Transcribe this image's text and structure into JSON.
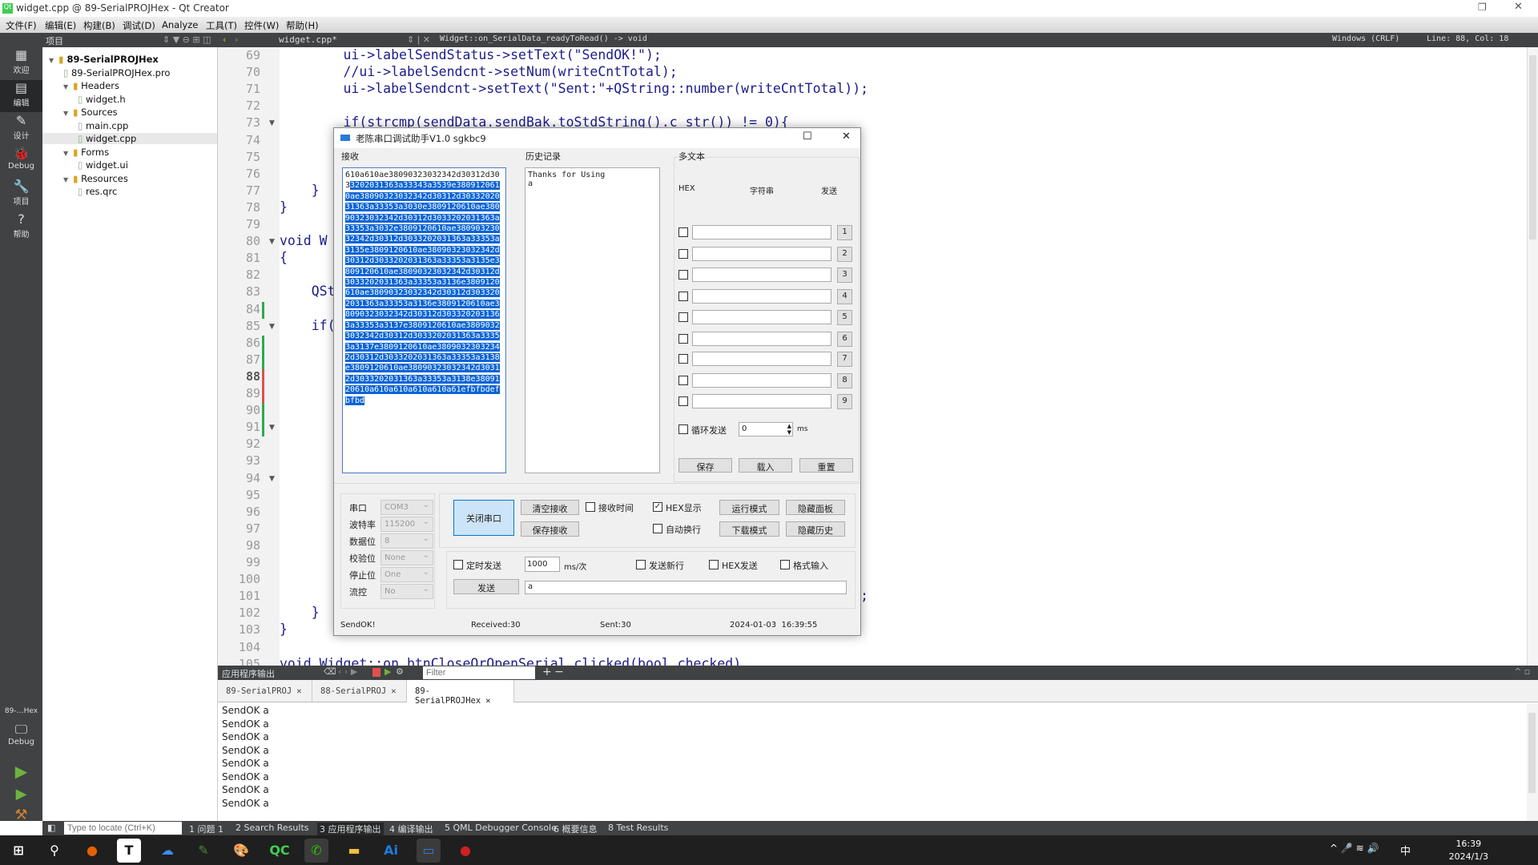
{
  "window": {
    "title": "widget.cpp @ 89-SerialPROJHex - Qt Creator"
  },
  "menu": [
    "文件(F)",
    "编辑(E)",
    "构建(B)",
    "调试(D)",
    "Analyze",
    "工具(T)",
    "控件(W)",
    "帮助(H)"
  ],
  "toolbar": {
    "project_label": "项目",
    "file_tab": "widget.cpp*",
    "function": "Widget::on_SerialData_readyToRead() -> void",
    "line_ending": "Windows (CRLF)",
    "position": "Line: 88, Col: 18"
  },
  "modes": [
    {
      "label": "欢迎",
      "icon": "grid-icon"
    },
    {
      "label": "编辑",
      "icon": "edit-icon"
    },
    {
      "label": "设计",
      "icon": "pen-icon"
    },
    {
      "label": "Debug",
      "icon": "bug-icon"
    },
    {
      "label": "项目",
      "icon": "wrench-icon"
    },
    {
      "label": "帮助",
      "icon": "help-icon"
    }
  ],
  "modes_bottom": {
    "project": "89-…Hex",
    "kit": "Debug"
  },
  "tree": [
    {
      "label": "89-SerialPROJHex",
      "depth": 0,
      "bold": true
    },
    {
      "label": "89-SerialPROJHex.pro",
      "depth": 1
    },
    {
      "label": "Headers",
      "depth": 1
    },
    {
      "label": "widget.h",
      "depth": 2
    },
    {
      "label": "Sources",
      "depth": 1
    },
    {
      "label": "main.cpp",
      "depth": 2
    },
    {
      "label": "widget.cpp",
      "depth": 2,
      "selected": true
    },
    {
      "label": "Forms",
      "depth": 1
    },
    {
      "label": "widget.ui",
      "depth": 2
    },
    {
      "label": "Resources",
      "depth": 1
    },
    {
      "label": "res.qrc",
      "depth": 2
    }
  ],
  "editor": {
    "current_line": 88,
    "lines": [
      {
        "n": 69,
        "text": "        ui->labelSendStatus->setText(\"SendOK!\");"
      },
      {
        "n": 70,
        "text": "        //ui->labelSendcnt->setNum(writeCntTotal);"
      },
      {
        "n": 71,
        "text": "        ui->labelSendcnt->setText(\"Sent:\"+QString::number(writeCntTotal));"
      },
      {
        "n": 72,
        "text": ""
      },
      {
        "n": 73,
        "text": "        if(strcmp(sendData.sendBak.toStdString().c_str()) != 0){",
        "fold": true
      },
      {
        "n": 74,
        "text": ""
      },
      {
        "n": 75,
        "text": ""
      },
      {
        "n": 76,
        "text": ""
      },
      {
        "n": 77,
        "text": "    }"
      },
      {
        "n": 78,
        "text": "}"
      },
      {
        "n": 79,
        "text": ""
      },
      {
        "n": 80,
        "text": "void W",
        "fold": true
      },
      {
        "n": 81,
        "text": "{"
      },
      {
        "n": 82,
        "text": ""
      },
      {
        "n": 83,
        "text": "    QSt"
      },
      {
        "n": 84,
        "text": "",
        "mark": "green"
      },
      {
        "n": 85,
        "text": "    if(",
        "fold": true
      },
      {
        "n": 86,
        "text": "",
        "mark": "green"
      },
      {
        "n": 87,
        "text": "",
        "mark": "green"
      },
      {
        "n": 88,
        "text": "",
        "mark": "red"
      },
      {
        "n": 89,
        "text": "",
        "mark": "red"
      },
      {
        "n": 90,
        "text": "",
        "mark": "green"
      },
      {
        "n": 91,
        "text": "",
        "fold": true,
        "mark": "green"
      },
      {
        "n": 92,
        "text": ""
      },
      {
        "n": 93,
        "text": ""
      },
      {
        "n": 94,
        "text": "",
        "fold": true
      },
      {
        "n": 95,
        "text": ""
      },
      {
        "n": 96,
        "text": ""
      },
      {
        "n": 97,
        "text": ""
      },
      {
        "n": 98,
        "text": ""
      },
      {
        "n": 99,
        "text": ""
      },
      {
        "n": 100,
        "text": ""
      },
      {
        "n": 101,
        "text": "                                                                       ));"
      },
      {
        "n": 102,
        "text": "    }"
      },
      {
        "n": 103,
        "text": "}"
      },
      {
        "n": 104,
        "text": ""
      },
      {
        "n": 105,
        "text": "void Widget::on_btnCloseOrOpenSerial_clicked(bool checked)"
      }
    ]
  },
  "output": {
    "title": "应用程序输出",
    "filter_placeholder": "Filter",
    "tabs": [
      {
        "label": "89-SerialPROJ"
      },
      {
        "label": "88-SerialPROJ"
      },
      {
        "label": "89-SerialPROJHex",
        "active": true
      }
    ],
    "lines": [
      "SendOK a",
      "SendOK a",
      "SendOK a",
      "SendOK a",
      "SendOK a",
      "SendOK a",
      "SendOK a",
      "SendOK a"
    ]
  },
  "statusbar": {
    "locate_placeholder": "Type to locate (Ctrl+K)",
    "items": [
      "1 问题 1",
      "2 Search Results",
      "3 应用程序输出",
      "4 编译输出",
      "5 QML Debugger Console",
      "6 概要信息",
      "8 Test Results"
    ],
    "active_index": 2
  },
  "taskbar": {
    "apps": [
      "windows-start",
      "search",
      "firefox",
      "typora",
      "baidu-netdisk",
      "notepad",
      "paint",
      "qt-creator",
      "wechat",
      "file-explorer",
      "ai-app",
      "serial-tool",
      "recorder"
    ],
    "time": "16:39",
    "date": "2024/1/3",
    "ime": "中"
  },
  "dialog": {
    "title": "老陈串口调试助手V1.0 sgkbc9",
    "recv_label": "接收",
    "recv_plain": "610a610ae38090323032342d30312d303",
    "recv_selected": "3202031363a33343a3539e3809120610ae38090323032342d30312d3033202031363a33353a3030e3809120610ae38090323032342d30312d3033202031363a33353a3032e3809120610ae38090323032342d30312d3033202031363a33353a3135e3809120610ae38090323032342d30312d3033202031363a33353a3135e3809120610ae38090323032342d30312d3033202031363a33353a3136e3809120610ae38090323032342d30312d3033202031363a33353a3136e3809120610ae38090323032342d30312d3033202031363a33353a3137e3809120610ae38090323032342d30312d3033202031363a33353a3137e3809120610ae38090323032342d30312d3033202031363a33353a3138e3809120610ae38090323032342d30312d3033202031363a33353a3138e3809120610a610a610a610a610a61efbfbdefbfbd",
    "history_label": "历史记录",
    "history_text": "Thanks for Using\na",
    "multi": {
      "label": "多文本",
      "col_hex": "HEX",
      "col_str": "字符串",
      "col_send": "发送",
      "rows": [
        "1",
        "2",
        "3",
        "4",
        "5",
        "6",
        "7",
        "8",
        "9"
      ],
      "loop_label": "循环发送",
      "loop_value": "0",
      "loop_unit": "ms",
      "save": "保存",
      "load": "载入",
      "reset": "重置"
    },
    "settings": [
      {
        "label": "串口",
        "value": "COM3"
      },
      {
        "label": "波特率",
        "value": "115200"
      },
      {
        "label": "数据位",
        "value": "8"
      },
      {
        "label": "校验位",
        "value": "None"
      },
      {
        "label": "停止位",
        "value": "One"
      },
      {
        "label": "流控",
        "value": "No"
      }
    ],
    "close_port": "关闭串口",
    "clear_recv": "清空接收",
    "save_recv": "保存接收",
    "recv_time": {
      "label": "接收时间",
      "checked": false
    },
    "hex_display": {
      "label": "HEX显示",
      "checked": true
    },
    "auto_wrap": {
      "label": "自动换行",
      "checked": false
    },
    "run_mode": "运行模式",
    "download_mode": "下载模式",
    "hide_panel": "隐藏面板",
    "hide_history": "隐藏历史",
    "timed_send": {
      "label": "定时发送",
      "checked": false
    },
    "interval": "1000",
    "interval_unit": "ms/次",
    "send_newline": {
      "label": "发送新行",
      "checked": false
    },
    "hex_send": {
      "label": "HEX发送",
      "checked": false
    },
    "format_input": {
      "label": "格式输入",
      "checked": false
    },
    "send": "发送",
    "send_text": "a",
    "status": {
      "send_status": "SendOK!",
      "received": "Received:30",
      "sent": "Sent:30",
      "datetime": "2024-01-03  16:39:55"
    }
  }
}
